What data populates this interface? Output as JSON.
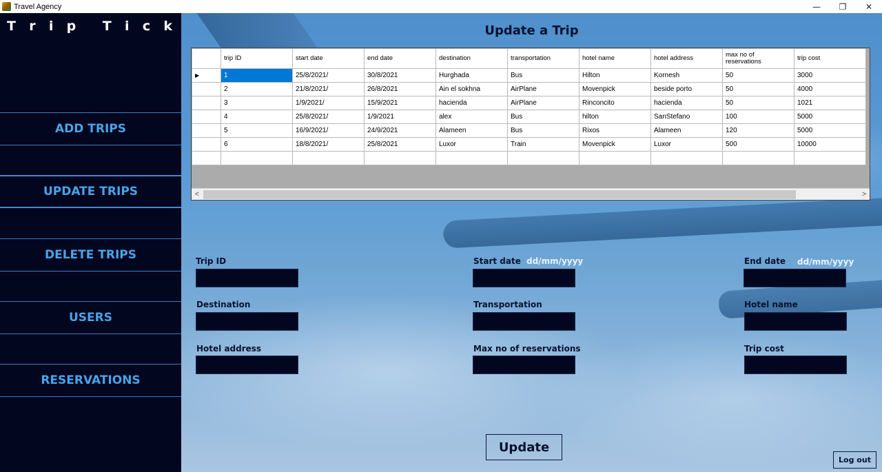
{
  "window": {
    "title": "Travel Agency",
    "minimize_glyph": "—",
    "restore_glyph": "❐",
    "close_glyph": "✕"
  },
  "sidebar": {
    "brand_letters": [
      "T",
      "r",
      "i",
      "p",
      "",
      "T",
      "i",
      "c",
      "k"
    ],
    "items": [
      {
        "label": "ADD TRIPS"
      },
      {
        "label": "UPDATE TRIPS"
      },
      {
        "label": "DELETE TRIPS"
      },
      {
        "label": "USERS"
      },
      {
        "label": "RESERVATIONS"
      }
    ]
  },
  "main": {
    "title": "Update a Trip",
    "grid": {
      "columns": [
        "trip ID",
        "start date",
        "end date",
        "destination",
        "transportation",
        "hotel name",
        "hotel address",
        "max no of reservations",
        "trip cost"
      ],
      "rows": [
        [
          "1",
          "25/8/2021/",
          "30/8/2021",
          "Hurghada",
          "Bus",
          "Hilton",
          "Kornesh",
          "50",
          "3000"
        ],
        [
          "2",
          "21/8/2021/",
          "26/8/2021",
          "Ain el sokhna",
          "AirPlane",
          "Movenpick",
          "beside porto",
          "50",
          "4000"
        ],
        [
          "3",
          "1/9/2021/",
          "15/9/2021",
          "hacienda",
          "AirPlane",
          "Rinconcito",
          "hacienda",
          "50",
          "1021"
        ],
        [
          "4",
          "25/8/2021/",
          "1/9/2021",
          "alex",
          "Bus",
          "hilton",
          "SanStefano",
          "100",
          "5000"
        ],
        [
          "5",
          "16/9/2021/",
          "24/9/2021",
          "Alameen",
          "Bus",
          "Rixos",
          "Alameen",
          "120",
          "5000"
        ],
        [
          "6",
          "18/8/2021/",
          "25/8/2021",
          "Luxor",
          "Train",
          "Movenpick",
          "Luxor",
          "500",
          "10000"
        ]
      ],
      "selected_row_marker": "▶",
      "scroll_left": "<",
      "scroll_right": ">"
    },
    "form": {
      "trip_id_label": "Trip ID",
      "start_date_label": "Start date",
      "start_date_hint": "dd/mm/yyyy",
      "end_date_label": "End date",
      "end_date_hint": "dd/mm/yyyy",
      "destination_label": "Destination",
      "transportation_label": "Transportation",
      "hotel_name_label": "Hotel name",
      "hotel_address_label": "Hotel address",
      "max_res_label": "Max no of reservations",
      "trip_cost_label": "Trip cost"
    },
    "update_label": "Update",
    "logout_label": "Log out"
  }
}
